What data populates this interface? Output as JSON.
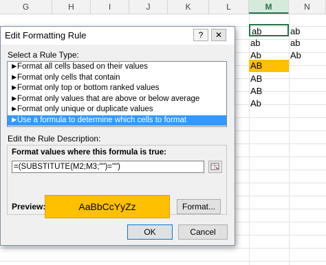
{
  "sheet": {
    "columns": [
      "G",
      "H",
      "I",
      "J",
      "K",
      "L",
      "M",
      "N"
    ],
    "active_column": "M",
    "cells_m": [
      "ab",
      "ab",
      "Ab",
      "AB",
      "AB",
      "AB",
      "Ab"
    ],
    "cells_n": [
      "ab",
      "ab",
      "Ab"
    ],
    "highlight_color": "#ffc000"
  },
  "dialog": {
    "title": "Edit Formatting Rule",
    "help_label": "?",
    "close_label": "✕",
    "rule_type_label": "Select a Rule Type:",
    "rule_types": [
      "Format all cells based on their values",
      "Format only cells that contain",
      "Format only top or bottom ranked values",
      "Format only values that are above or below average",
      "Format only unique or duplicate values",
      "Use a formula to determine which cells to format"
    ],
    "selected_rule_index": 5,
    "description_label": "Edit the Rule Description:",
    "formula_label": "Format values where this formula is true:",
    "formula_value": "=(SUBSTITUTE(M2;M3;\"\")=\"\")",
    "preview_label": "Preview:",
    "preview_text": "AaBbCcYyZz",
    "format_button": "Format...",
    "ok_button": "OK",
    "cancel_button": "Cancel"
  }
}
